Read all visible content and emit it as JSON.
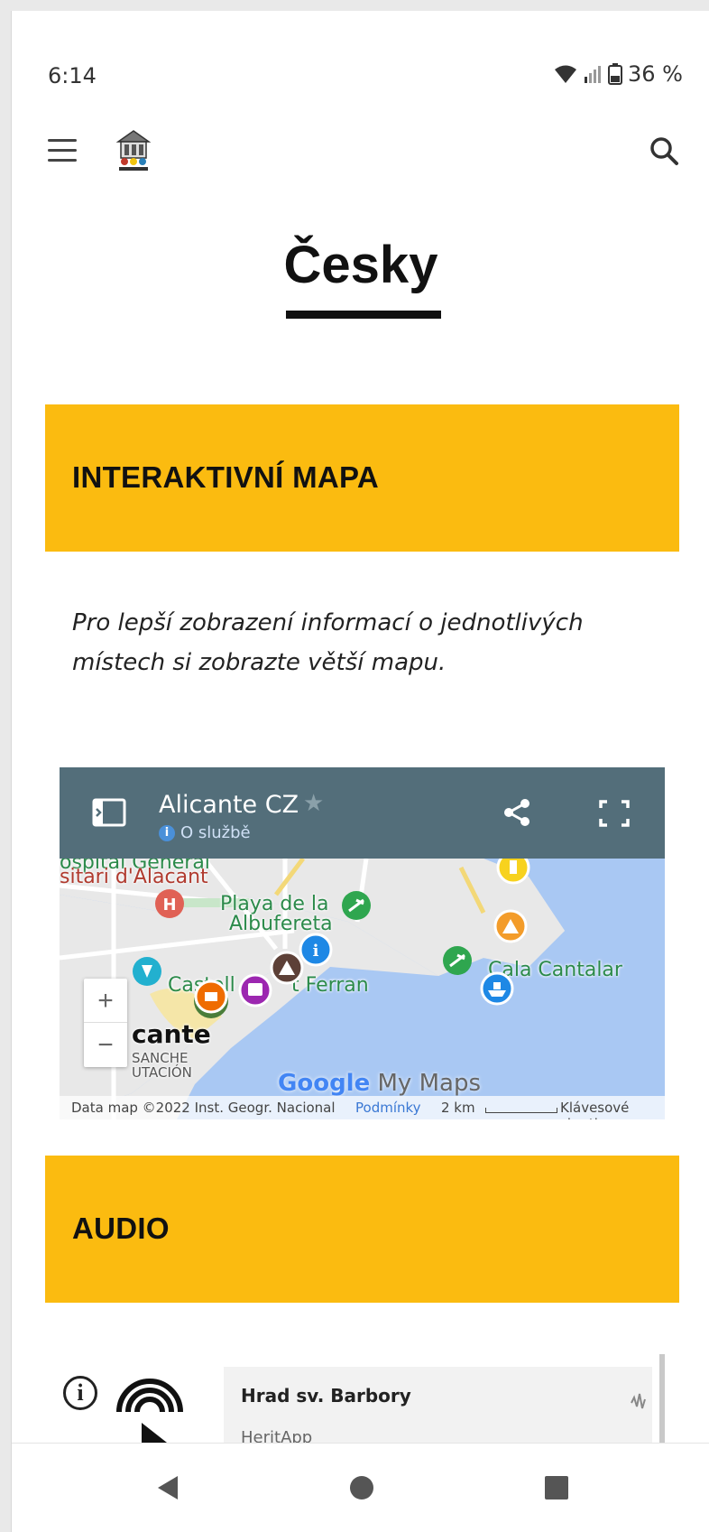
{
  "status": {
    "time": "6:14",
    "battery": "36 %"
  },
  "page": {
    "language_title": "Česky"
  },
  "sections": {
    "map_heading": "INTERAKTIVNÍ MAPA",
    "map_intro": "Pro lepší zobrazení informací o jednotlivých místech si zobrazte větší mapu.",
    "audio_heading": "AUDIO"
  },
  "map": {
    "title": "Alicante CZ",
    "subtitle": "O službě",
    "labels": {
      "hospital": "sitari d'Alacant",
      "hospital_top": "ospital General",
      "playa": "Playa de la",
      "playa2": "Albufereta",
      "castell": "Castell",
      "ferran": "t Ferran",
      "cala": "Cala Cantalar",
      "city": "cante",
      "district1": "SANCHE",
      "district2": "UTACIÓN"
    },
    "brand_google": "Google",
    "brand_mymaps": "My Maps",
    "footer": {
      "attribution": "Data map ©2022 Inst. Geogr. Nacional",
      "terms": "Podmínky",
      "scale": "2 km",
      "shortcuts": "Klávesové zkratky"
    },
    "zoom_in": "+",
    "zoom_out": "−"
  },
  "audio_player": {
    "track_title": "Hrad sv. Barbory",
    "artist": "HeritApp"
  },
  "colors": {
    "accent": "#fbbb10",
    "map_header": "#536e7a",
    "water": "#a9c8f3"
  }
}
